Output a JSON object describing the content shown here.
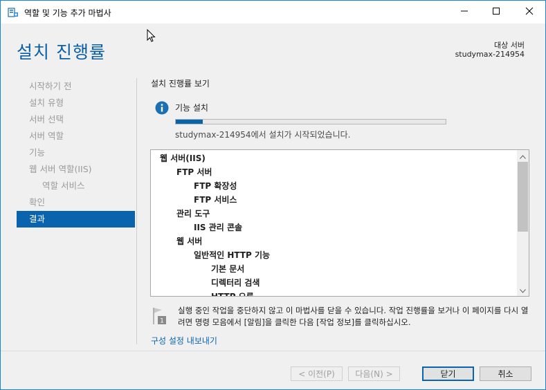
{
  "window": {
    "title": "역할 및 기능 추가 마법사",
    "minimize_icon": "minimize-icon",
    "maximize_icon": "maximize-icon",
    "close_icon": "close-icon"
  },
  "header": {
    "page_title": "설치 진행률",
    "target_label": "대상 서버",
    "target_name": "studymax-214954"
  },
  "sidebar": {
    "items": [
      {
        "label": "시작하기 전",
        "state": "disabled"
      },
      {
        "label": "설치 유형",
        "state": "disabled"
      },
      {
        "label": "서버 선택",
        "state": "disabled"
      },
      {
        "label": "서버 역할",
        "state": "disabled"
      },
      {
        "label": "기능",
        "state": "disabled"
      },
      {
        "label": "웹 서버 역할(IIS)",
        "state": "disabled"
      },
      {
        "label": "역할 서비스",
        "state": "disabled"
      },
      {
        "label": "확인",
        "state": "disabled"
      },
      {
        "label": "결과",
        "state": "active"
      }
    ]
  },
  "main": {
    "section_label": "설치 진행률 보기",
    "status_label": "기능 설치",
    "progress": 0.1,
    "progress_message": "studymax-214954에서 설치가 시작되었습니다.",
    "tree": [
      {
        "label": "웹 서버(IIS)",
        "level": 0
      },
      {
        "label": "FTP 서버",
        "level": 1
      },
      {
        "label": "FTP 확장성",
        "level": 2
      },
      {
        "label": "FTP 서비스",
        "level": 2
      },
      {
        "label": "관리 도구",
        "level": 1
      },
      {
        "label": "IIS 관리 콘솔",
        "level": 2
      },
      {
        "label": "웹 서버",
        "level": 1
      },
      {
        "label": "일반적인 HTTP 기능",
        "level": 2
      },
      {
        "label": "기본 문서",
        "level": 3
      },
      {
        "label": "디렉터리 검색",
        "level": 3
      },
      {
        "label": "HTTP 오류",
        "level": 3
      }
    ],
    "notice_text": "실행 중인 작업을 중단하지 않고 이 마법사를 닫을 수 있습니다. 작업 진행률을 보거나 이 페이지를 다시 열려면 명령 모음에서 [알림]을 클릭한 다음 [작업 정보]를 클릭하십시오.",
    "notice_badge": "1",
    "export_link": "구성 설정 내보내기"
  },
  "footer": {
    "prev_label": "< 이전(P)",
    "next_label": "다음(N) >",
    "close_label": "닫기",
    "cancel_label": "취소"
  },
  "colors": {
    "accent": "#0a64ad",
    "title_blue": "#0b5fa5",
    "window_border": "#1883d7"
  }
}
